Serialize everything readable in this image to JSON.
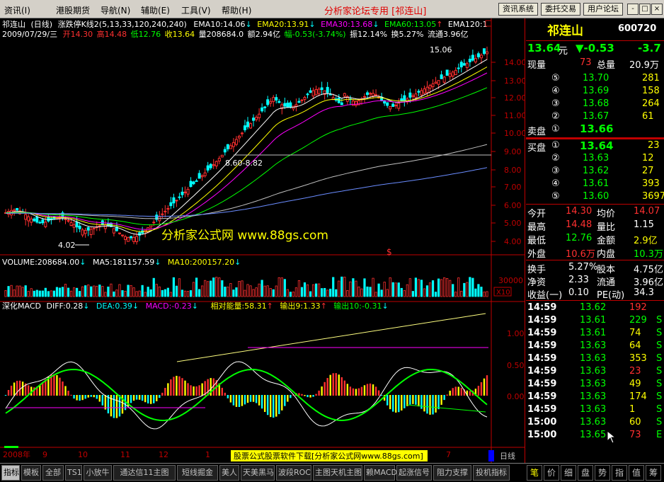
{
  "menu": {
    "items": [
      "资讯(I)",
      "港股期货",
      "导航(N)",
      "辅助(E)",
      "工具(V)",
      "帮助(H)"
    ],
    "title": "分析家论坛专用 [祁连山]",
    "buttons": [
      "资讯系统",
      "委托交易",
      "用户论坛"
    ],
    "window_controls": [
      "-",
      "□",
      "×"
    ]
  },
  "chart": {
    "header1": {
      "name": "祁连山",
      "period": "(日线)",
      "indicator": "涨跌停K线2(5,13,33,120,240,240)",
      "ema": [
        {
          "text": "EMA10:14.06",
          "arrow": "↓",
          "color": "#ffffff"
        },
        {
          "text": "EMA20:13.91",
          "arrow": "↓",
          "color": "#ffff00"
        },
        {
          "text": "EMA30:13.68",
          "arrow": "↓",
          "color": "#ff00ff"
        },
        {
          "text": "EMA60:13.05",
          "arrow": "↑",
          "color": "#00ff00"
        },
        {
          "text": "EMA120:1",
          "arrow": "",
          "color": "#ffffff"
        }
      ]
    },
    "header2": {
      "date": "2009/07/29/三",
      "open_label": "开",
      "open": "14.30",
      "high_label": "高",
      "high": "14.48",
      "low_label": "低",
      "low": "12.76",
      "close_label": "收",
      "close": "13.64",
      "vol_label": "量",
      "vol": "208684.0",
      "amt_label": "额",
      "amt": "2.94亿",
      "range_label": "幅",
      "range": "-0.53(-3.74%)",
      "amp_label": "振",
      "amp": "12.14%",
      "turn_label": "换",
      "turn": "5.27%",
      "float_label": "流通",
      "float": "3.96亿"
    },
    "price_axis": [
      "14.00",
      "13.00",
      "12.00",
      "11.00",
      "10.00",
      "9.00",
      "8.00",
      "7.00",
      "6.00",
      "5.00",
      "4.00"
    ],
    "annotations": {
      "high": "15.06",
      "low": "4.02",
      "mid": "8.60-8.82",
      "dollar": "$",
      "watermark": "分析家公式网 www.88gs.com"
    },
    "volume_header": {
      "volume": "VOLUME:208684.00",
      "vol_arrow": "↓",
      "ma5": "MA5:181157.59",
      "ma5_arrow": "↓",
      "ma10": "MA10:200157.20",
      "ma10_arrow": "↓"
    },
    "volume_axis": {
      "level": "30000",
      "unit": "X10"
    },
    "macd_header": {
      "name": "深化MACD",
      "diff": "DIFF:0.28",
      "diff_arrow": "↓",
      "dea": "DEA:0.39",
      "dea_arrow": "↓",
      "macd": "MACD:-0.23",
      "macd_arrow": "↓",
      "energy": "相对能量:58.31",
      "energy_arrow": "↑",
      "out9": "输出9:1.33",
      "out9_arrow": "↑",
      "out10": "输出10:-0.31",
      "out10_arrow": "↓"
    },
    "macd_axis": [
      "1.00",
      "0.50",
      "0.00"
    ],
    "date_axis": [
      "2008年",
      "9",
      "10",
      "11",
      "12",
      "1",
      "7"
    ],
    "footer_banner": "股票公式股票软件下载[分析家公式网www.88gs.com]",
    "period_label": "日线"
  },
  "quote": {
    "name": "祁连山",
    "code": "600720",
    "price": "13.64",
    "price_unit": "元",
    "change": "▼-0.53",
    "change_pct": "-3.7",
    "now_vol_label": "现量",
    "now_vol": "73",
    "total_vol_label": "总量",
    "total_vol": "20.9万",
    "sell": [
      {
        "n": "⑤",
        "p": "13.70",
        "v": "281"
      },
      {
        "n": "④",
        "p": "13.69",
        "v": "158"
      },
      {
        "n": "③",
        "p": "13.68",
        "v": "264"
      },
      {
        "n": "②",
        "p": "13.67",
        "v": "61"
      }
    ],
    "sell1_label": "卖盘",
    "sell1": {
      "n": "①",
      "p": "13.66"
    },
    "buy1_label": "买盘",
    "buy1": {
      "n": "①",
      "p": "13.64",
      "v": "23"
    },
    "buy": [
      {
        "n": "②",
        "p": "13.63",
        "v": "12"
      },
      {
        "n": "③",
        "p": "13.62",
        "v": "27"
      },
      {
        "n": "④",
        "p": "13.61",
        "v": "393"
      },
      {
        "n": "⑤",
        "p": "13.60",
        "v": "3697"
      }
    ],
    "stats": [
      {
        "l1": "今开",
        "v1": "14.30",
        "c1": "#ff3030",
        "l2": "均价",
        "v2": "14.07",
        "c2": "#ff3030"
      },
      {
        "l1": "最高",
        "v1": "14.48",
        "c1": "#ff3030",
        "l2": "量比",
        "v2": "1.15",
        "c2": "#ffffff"
      },
      {
        "l1": "最低",
        "v1": "12.76",
        "c1": "#00ff00",
        "l2": "金额",
        "v2": "2.9亿",
        "c2": "#ffff00"
      },
      {
        "l1": "外盘",
        "v1": "10.6万",
        "c1": "#ff3030",
        "l2": "内盘",
        "v2": "10.3万",
        "c2": "#00ff00"
      }
    ],
    "stats2": [
      {
        "l1": "换手",
        "v1": "5.27%",
        "l2": "股本",
        "v2": "4.75亿"
      },
      {
        "l1": "净资",
        "v1": "2.33",
        "l2": "流通",
        "v2": "3.96亿"
      },
      {
        "l1": "收益(一)",
        "v1": "0.10",
        "l2": "PE(动)",
        "v2": "34.3"
      }
    ],
    "ticks": [
      {
        "t": "14:59",
        "p": "13.62",
        "v": "192",
        "c": "#ff3030"
      },
      {
        "t": "14:59",
        "p": "13.61",
        "v": "229",
        "c": "#00ff00",
        "s": "S"
      },
      {
        "t": "14:59",
        "p": "13.61",
        "v": "74",
        "c": "#ffff00",
        "s": "S"
      },
      {
        "t": "14:59",
        "p": "13.63",
        "v": "64",
        "c": "#ffff00",
        "s": "S"
      },
      {
        "t": "14:59",
        "p": "13.63",
        "v": "353",
        "c": "#ffff00",
        "s": "S"
      },
      {
        "t": "14:59",
        "p": "13.63",
        "v": "23",
        "c": "#ff3030",
        "s": "S"
      },
      {
        "t": "14:59",
        "p": "13.63",
        "v": "49",
        "c": "#ffff00",
        "s": "S"
      },
      {
        "t": "14:59",
        "p": "13.63",
        "v": "174",
        "c": "#ffff00",
        "s": "S"
      },
      {
        "t": "14:59",
        "p": "13.63",
        "v": "1",
        "c": "#ffff00",
        "s": "S"
      },
      {
        "t": "15:00",
        "p": "13.63",
        "v": "60",
        "c": "#ffff00",
        "s": "S"
      },
      {
        "t": "15:00",
        "p": "13.65",
        "v": "73",
        "c": "#ff3030",
        "s": "E"
      }
    ]
  },
  "tabs": {
    "left": [
      "指标",
      "模板",
      "全部",
      "TS1",
      "小放牛",
      "通达信11主图",
      "短线掘金",
      "美人",
      "天美黑马",
      "波段ROC",
      "主图天机主图",
      "赖MACD",
      "起涨信号",
      "阻力支撑",
      "投机指标"
    ],
    "right": [
      "笔",
      "价",
      "细",
      "盘",
      "势",
      "指",
      "值",
      "筹"
    ]
  },
  "colors": {
    "up": "#ff3030",
    "down": "#00ffff",
    "green": "#00ff00",
    "yellow": "#ffff00",
    "magenta": "#ff00ff",
    "white": "#ffffff",
    "axisred": "#c00000"
  }
}
